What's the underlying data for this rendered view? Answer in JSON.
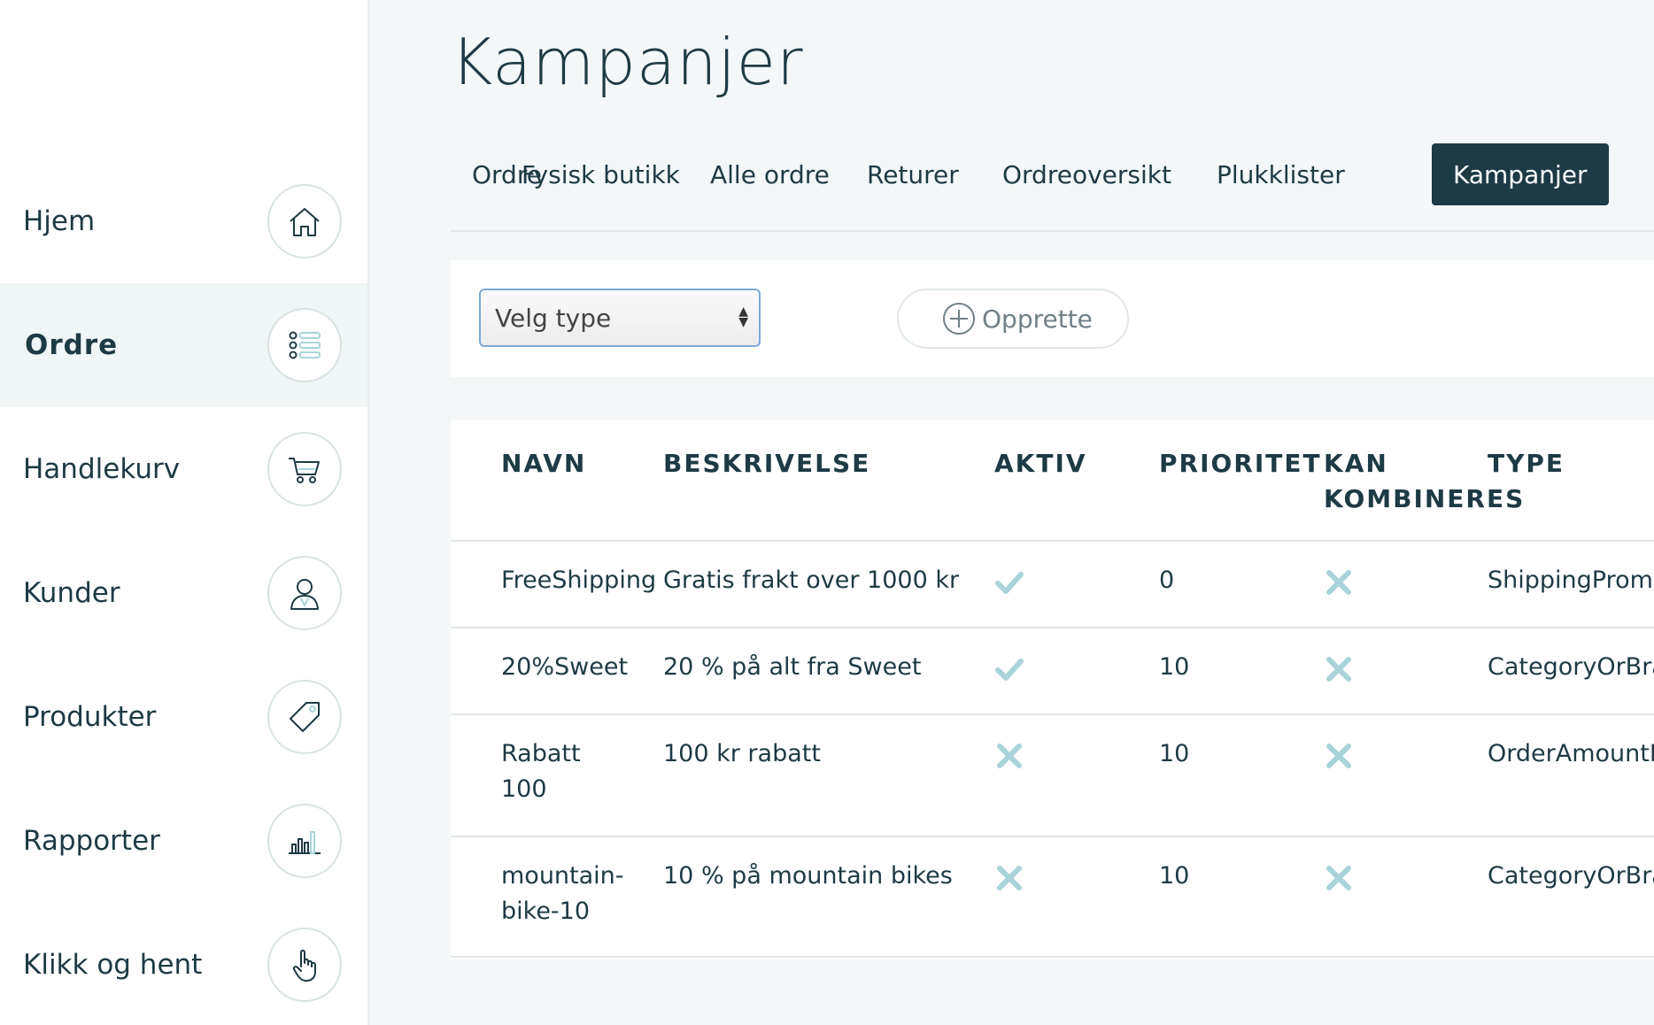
{
  "sidebar": {
    "items": [
      {
        "label": "Hjem",
        "icon": "home-icon",
        "active": false
      },
      {
        "label": "Ordre",
        "icon": "list-icon",
        "active": true
      },
      {
        "label": "Handlekurv",
        "icon": "cart-icon",
        "active": false
      },
      {
        "label": "Kunder",
        "icon": "user-icon",
        "active": false
      },
      {
        "label": "Produkter",
        "icon": "tag-icon",
        "active": false
      },
      {
        "label": "Rapporter",
        "icon": "bar-chart-icon",
        "active": false
      },
      {
        "label": "Klikk og hent",
        "icon": "pointer-hand-icon",
        "active": false
      }
    ]
  },
  "page": {
    "title": "Kampanjer"
  },
  "tabs": [
    {
      "label": "Ordre",
      "active": false
    },
    {
      "label": "Fysisk butikk",
      "active": false
    },
    {
      "label": "Alle ordre",
      "active": false
    },
    {
      "label": "Returer",
      "active": false
    },
    {
      "label": "Ordreoversikt",
      "active": false
    },
    {
      "label": "Plukklister",
      "active": false
    },
    {
      "label": "Kampanjer",
      "active": true
    }
  ],
  "toolbar": {
    "select_value": "Velg type",
    "create_label": "Opprette"
  },
  "table": {
    "headers": {
      "name": "NAVN",
      "description": "BESKRIVELSE",
      "active": "AKTIV",
      "priority": "PRIORITET",
      "combinable_1": "KAN",
      "combinable_2": "KOMBINERES",
      "type": "TYPE"
    },
    "rows": [
      {
        "name_1": "FreeShipping",
        "name_2": "",
        "description": "Gratis frakt over 1000 kr",
        "active": true,
        "priority": "0",
        "combinable": false,
        "type": "ShippingPromo"
      },
      {
        "name_1": "20%Sweet",
        "name_2": "",
        "description": "20 % på alt fra Sweet",
        "active": true,
        "priority": "10",
        "combinable": false,
        "type": "CategoryOrBra"
      },
      {
        "name_1": "Rabatt",
        "name_2": "100",
        "description": "100 kr rabatt",
        "active": false,
        "priority": "10",
        "combinable": false,
        "type": "OrderAmountP"
      },
      {
        "name_1": "mountain-",
        "name_2": "bike-10",
        "description": "10 % på mountain bikes",
        "active": false,
        "priority": "10",
        "combinable": false,
        "type": "CategoryOrBra"
      }
    ]
  },
  "colors": {
    "accent_dark": "#1d3a45",
    "icon_teal": "#a9d3d8",
    "text": "#1e3a44"
  }
}
